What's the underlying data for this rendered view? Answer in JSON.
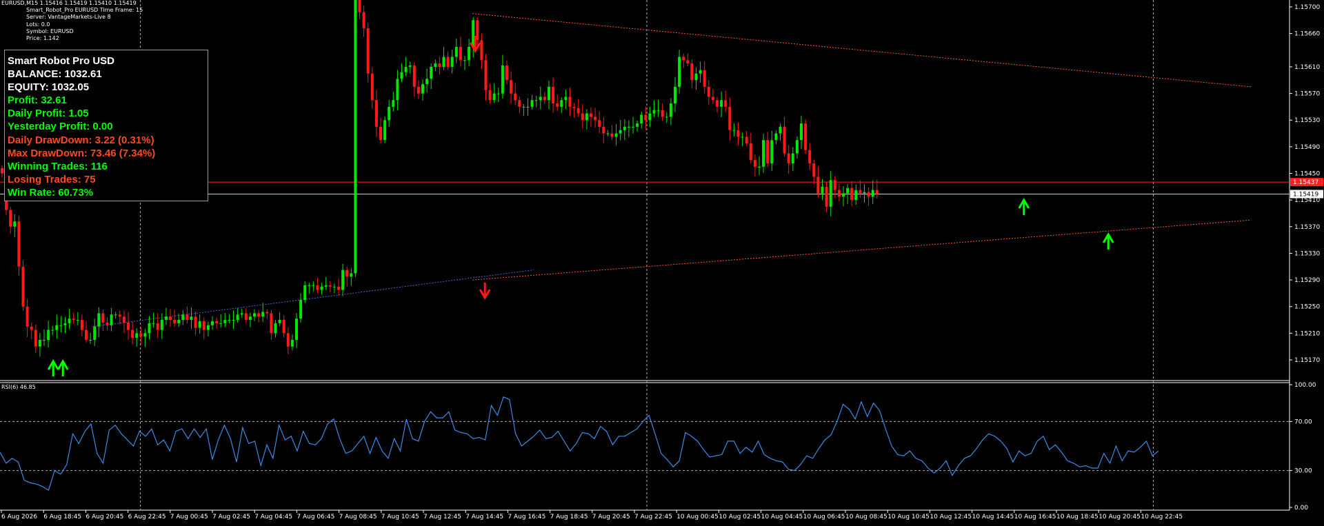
{
  "header": {
    "symbol_line": "EURUSD,M15  1.15416 1.15419 1.15410 1.15419",
    "indicator_lines": [
      "Smart_Robot_Pro  EURUSD  Time Frame: 15",
      "Server: VantageMarkets-Live 8",
      "Lots:  0.0",
      "Symbol: EURUSD",
      "Price:  1.142"
    ]
  },
  "stats_panel": {
    "title": "Smart Robot Pro USD",
    "balance": "BALANCE: 1032.61",
    "equity": "EQUITY: 1032.05",
    "profit": "Profit: 32.61",
    "daily_profit": "Daily Profit: 1.05",
    "yesterday_profit": "Yesterday Profit: 0.00",
    "daily_drawdown": "Daily DrawDown: 3.22 (0.31%)",
    "max_drawdown": "Max DrawDown: 73.46 (7.34%)",
    "winning_trades": "Winning Trades: 116",
    "losing_trades": "Losing Trades: 75",
    "win_rate": "Win Rate: 60.73%"
  },
  "rsi_label": "RSI(6) 46.85",
  "colors": {
    "bull": "#00e600",
    "bear": "#ff1a1a",
    "rsi": "#3c8ce6",
    "grid": "#b4b4b4",
    "bid_line": "#d0d0d0",
    "red_line": "#ff2020",
    "trend_red": "#ff5a28",
    "trend_blue": "#3c6edc",
    "up_arrow": "#00ff00",
    "down_arrow": "#ff1a1a"
  },
  "chart_data": [
    {
      "type": "candlestick",
      "symbol": "EURUSD",
      "timeframe": "M15",
      "ylim": [
        1.1514,
        1.157
      ],
      "y_ticks": [
        "1.15700",
        "1.15660",
        "1.15610",
        "1.15570",
        "1.15530",
        "1.15490",
        "1.15450",
        "1.15410",
        "1.15370",
        "1.15330",
        "1.15290",
        "1.15250",
        "1.15210",
        "1.15170"
      ],
      "x_ticks": [
        "6 Aug 2026",
        "6 Aug 18:45",
        "6 Aug 20:45",
        "6 Aug 22:45",
        "7 Aug 00:45",
        "7 Aug 02:45",
        "7 Aug 04:45",
        "7 Aug 06:45",
        "7 Aug 08:45",
        "7 Aug 10:45",
        "7 Aug 12:45",
        "7 Aug 14:45",
        "7 Aug 16:45",
        "7 Aug 18:45",
        "7 Aug 20:45",
        "7 Aug 22:45",
        "10 Aug 00:45",
        "10 Aug 02:45",
        "10 Aug 04:45",
        "10 Aug 06:45",
        "10 Aug 08:45",
        "10 Aug 10:45",
        "10 Aug 12:45",
        "10 Aug 14:45",
        "10 Aug 16:45",
        "10 Aug 18:45",
        "10 Aug 20:45",
        "10 Aug 22:45"
      ],
      "close_series": [
        1.1545,
        1.15395,
        1.1537,
        1.15378,
        1.1531,
        1.1525,
        1.1522,
        1.15215,
        1.1519,
        1.152,
        1.152,
        1.15215,
        1.15215,
        1.15222,
        1.15222,
        1.15225,
        1.15232,
        1.1523,
        1.1523,
        1.15215,
        1.152,
        1.152,
        1.1522,
        1.1524,
        1.15226,
        1.15222,
        1.15238,
        1.15238,
        1.15235,
        1.15226,
        1.15215,
        1.15203,
        1.1521,
        1.15205,
        1.1521,
        1.15225,
        1.15225,
        1.15215,
        1.1523,
        1.15235,
        1.1523,
        1.15225,
        1.1523,
        1.15238,
        1.1523,
        1.15235,
        1.15218,
        1.15228,
        1.15215,
        1.15222,
        1.15228,
        1.15225,
        1.15225,
        1.1523,
        1.1523,
        1.1523,
        1.15238,
        1.1524,
        1.1523,
        1.15235,
        1.1524,
        1.15235,
        1.15242,
        1.1524,
        1.1521,
        1.15225,
        1.1523,
        1.1521,
        1.1519,
        1.152,
        1.15232,
        1.1526,
        1.15282,
        1.15282,
        1.15282,
        1.15275,
        1.1528,
        1.15282,
        1.1528,
        1.1528,
        1.15275,
        1.15305,
        1.15295,
        1.153,
        1.15715,
        1.15692,
        1.15668,
        1.156,
        1.1556,
        1.1552,
        1.155,
        1.1553,
        1.1555,
        1.1556,
        1.15592,
        1.15602,
        1.1561,
        1.15612,
        1.1558,
        1.1557,
        1.15584,
        1.15592,
        1.1561,
        1.15615,
        1.1561,
        1.15625,
        1.1561,
        1.15625,
        1.1564,
        1.1562,
        1.1562,
        1.1564,
        1.1568,
        1.1565,
        1.1562,
        1.15575,
        1.1556,
        1.1557,
        1.1557,
        1.15612,
        1.1559,
        1.1557,
        1.1556,
        1.1555,
        1.1555,
        1.1555,
        1.1556,
        1.1556,
        1.15565,
        1.1556,
        1.1558,
        1.15555,
        1.1555,
        1.1556,
        1.15565,
        1.1555,
        1.15548,
        1.1554,
        1.1553,
        1.1554,
        1.15535,
        1.1553,
        1.1552,
        1.1551,
        1.1551,
        1.15505,
        1.1551,
        1.15515,
        1.1552,
        1.1552,
        1.1552,
        1.15525,
        1.15538,
        1.1553,
        1.1554,
        1.15545,
        1.15545,
        1.15535,
        1.15535,
        1.15555,
        1.1558,
        1.15625,
        1.1562,
        1.15615,
        1.1559,
        1.156,
        1.15605,
        1.1558,
        1.15565,
        1.1556,
        1.1555,
        1.1556,
        1.1555,
        1.15515,
        1.15515,
        1.15505,
        1.15505,
        1.15495,
        1.1547,
        1.1546,
        1.1546,
        1.155,
        1.15465,
        1.155,
        1.1551,
        1.1552,
        1.1548,
        1.15465,
        1.1548,
        1.155,
        1.15525,
        1.15485,
        1.15465,
        1.15445,
        1.1542,
        1.1543,
        1.154,
        1.1544,
        1.15425,
        1.15415,
        1.1542,
        1.15428,
        1.1541,
        1.15425,
        1.1542,
        1.15422,
        1.15415,
        1.15425,
        1.15419
      ],
      "horizontal_lines": [
        {
          "label": "1.15437",
          "color": "red_line"
        },
        {
          "label": "1.15419",
          "color": "bid_line"
        }
      ],
      "trendlines": [
        {
          "from": [
            "7 Aug 14:45",
            1.1569
          ],
          "to": [
            "10 Aug 22:45",
            1.1558
          ],
          "style": "dotted",
          "color": "trend_red"
        },
        {
          "from": [
            "7 Aug 14:45",
            1.1529
          ],
          "to": [
            "10 Aug 22:45",
            1.1538
          ],
          "style": "dotted",
          "color": "trend_red"
        },
        {
          "from": [
            "6 Aug 20:45",
            1.1522
          ],
          "to": [
            "7 Aug 12:45",
            1.15305
          ],
          "style": "dotted",
          "color": "trend_blue"
        }
      ],
      "signals": [
        {
          "type": "buy",
          "x": "6 Aug 18:45"
        },
        {
          "type": "buy",
          "x": "6 Aug 18:45"
        },
        {
          "type": "sell",
          "x": "7 Aug 14:45"
        },
        {
          "type": "sell",
          "x": "7 Aug 14:45"
        },
        {
          "type": "buy",
          "x": "10 Aug 16:45"
        },
        {
          "type": "buy",
          "x": "10 Aug 20:45"
        }
      ],
      "grid": false,
      "vertical_separators": [
        "6 Aug 22:45",
        "7 Aug 22:45",
        "10 Aug 22:45"
      ]
    },
    {
      "type": "line",
      "name": "RSI(6) 46.85",
      "ylim": [
        0,
        100
      ],
      "y_ticks": [
        "100.00",
        "70.00",
        "30.00",
        "0.00"
      ],
      "levels": [
        70,
        30
      ],
      "values": [
        45,
        36,
        40,
        37,
        22,
        20,
        19,
        17,
        14,
        30,
        27,
        35,
        60,
        52,
        62,
        68,
        44,
        36,
        63,
        67,
        60,
        55,
        50,
        62,
        58,
        64,
        51,
        55,
        46,
        62,
        64,
        56,
        64,
        57,
        64,
        39,
        55,
        67,
        56,
        37,
        65,
        52,
        54,
        34,
        51,
        40,
        67,
        55,
        58,
        46,
        62,
        52,
        51,
        56,
        68,
        72,
        56,
        44,
        46,
        52,
        58,
        44,
        57,
        46,
        40,
        56,
        46,
        72,
        56,
        54,
        70,
        78,
        73,
        73,
        78,
        63,
        61,
        60,
        56,
        57,
        55,
        83,
        75,
        90,
        88,
        60,
        50,
        54,
        58,
        63,
        56,
        57,
        62,
        54,
        46,
        52,
        61,
        60,
        56,
        66,
        62,
        51,
        58,
        58,
        61,
        64,
        70,
        75,
        60,
        44,
        39,
        33,
        38,
        61,
        58,
        54,
        47,
        41,
        42,
        43,
        54,
        54,
        44,
        49,
        45,
        54,
        43,
        40,
        38,
        37,
        31,
        30,
        35,
        42,
        40,
        48,
        55,
        59,
        70,
        84,
        80,
        72,
        86,
        74,
        85,
        79,
        64,
        50,
        43,
        42,
        46,
        40,
        38,
        32,
        28,
        32,
        38,
        26,
        34,
        40,
        42,
        48,
        55,
        60,
        58,
        54,
        48,
        37,
        46,
        42,
        44,
        54,
        58,
        47,
        51,
        45,
        38,
        36,
        33,
        34,
        32,
        32,
        44,
        36,
        50,
        38,
        46,
        45,
        49,
        54,
        42,
        46
      ],
      "value_label": "46.85"
    }
  ]
}
